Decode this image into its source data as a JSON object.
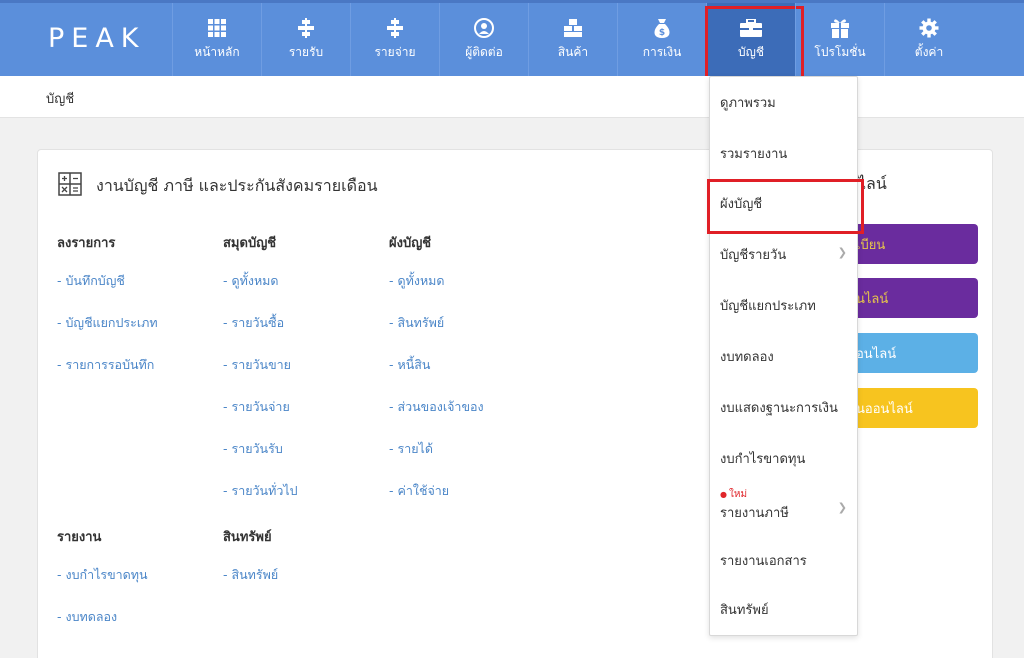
{
  "app": {
    "logo": "PEAK"
  },
  "nav": [
    {
      "label": "หน้าหลัก",
      "icon": "grid-icon"
    },
    {
      "label": "รายรับ",
      "icon": "income-icon"
    },
    {
      "label": "รายจ่าย",
      "icon": "expense-icon"
    },
    {
      "label": "ผู้ติดต่อ",
      "icon": "contact-icon"
    },
    {
      "label": "สินค้า",
      "icon": "boxes-icon"
    },
    {
      "label": "การเงิน",
      "icon": "money-bag-icon"
    },
    {
      "label": "บัญชี",
      "icon": "briefcase-icon",
      "active": true
    },
    {
      "label": "โปรโมชั่น",
      "icon": "gift-icon"
    },
    {
      "label": "ตั้งค่า",
      "icon": "gear-icon"
    }
  ],
  "breadcrumb": "บัญชี",
  "card": {
    "title": "งานบัญชี ภาษี และประกันสังคมรายเดือน",
    "columns": [
      {
        "heading": "ลงรายการ",
        "links": [
          "- บันทึกบัญชี",
          "- บัญชีแยกประเภท",
          "- รายการรอบันทึก"
        ]
      },
      {
        "heading": "สมุดบัญชี",
        "links": [
          "- ดูทั้งหมด",
          "- รายวันซื้อ",
          "- รายวันขาย",
          "- รายวันจ่าย",
          "- รายวันรับ",
          "- รายวันทั่วไป"
        ]
      },
      {
        "heading": "ผังบัญชี",
        "links": [
          "- ดูทั้งหมด",
          "- สินทรัพย์",
          "- หนี้สิน",
          "- ส่วนของเจ้าของ",
          "- รายได้",
          "- ค่าใช้จ่าย"
        ]
      }
    ],
    "reports": {
      "heading": "รายงาน",
      "links": [
        "- งบกำไรขาดทุน",
        "- งบทดลอง"
      ]
    },
    "assets": {
      "heading": "สินทรัพย์",
      "links": [
        "- สินทรัพย์"
      ]
    },
    "side_title": "ไลน์",
    "side_buttons": [
      {
        "label": "เบียน",
        "color": "#6a2c9e"
      },
      {
        "label": "นไลน์",
        "color": "#6a2c9e"
      },
      {
        "label": "อนไลน์",
        "color": "#5cb0e6"
      },
      {
        "label": "นออนไลน์",
        "color": "#f7c41f"
      }
    ]
  },
  "dropdown": {
    "items": [
      {
        "label": "ดูภาพรวม"
      },
      {
        "label": "รวมรายงาน"
      },
      {
        "label": "ผังบัญชี",
        "highlight": true
      },
      {
        "label": "บัญชีรายวัน",
        "submenu": true
      },
      {
        "label": "บัญชีแยกประเภท"
      },
      {
        "label": "งบทดลอง"
      },
      {
        "label": "งบแสดงฐานะการเงิน"
      },
      {
        "label": "งบกำไรขาดทุน"
      },
      {
        "label": "รายงานภาษี",
        "submenu": true,
        "badge": "ใหม่"
      },
      {
        "label": "รายงานเอกสาร"
      },
      {
        "label": "สินทรัพย์"
      }
    ]
  },
  "colors": {
    "nav_bg": "#5b8fdb",
    "nav_active": "#3c6cb8",
    "highlight": "#e01f26",
    "link": "#4b86c8"
  }
}
